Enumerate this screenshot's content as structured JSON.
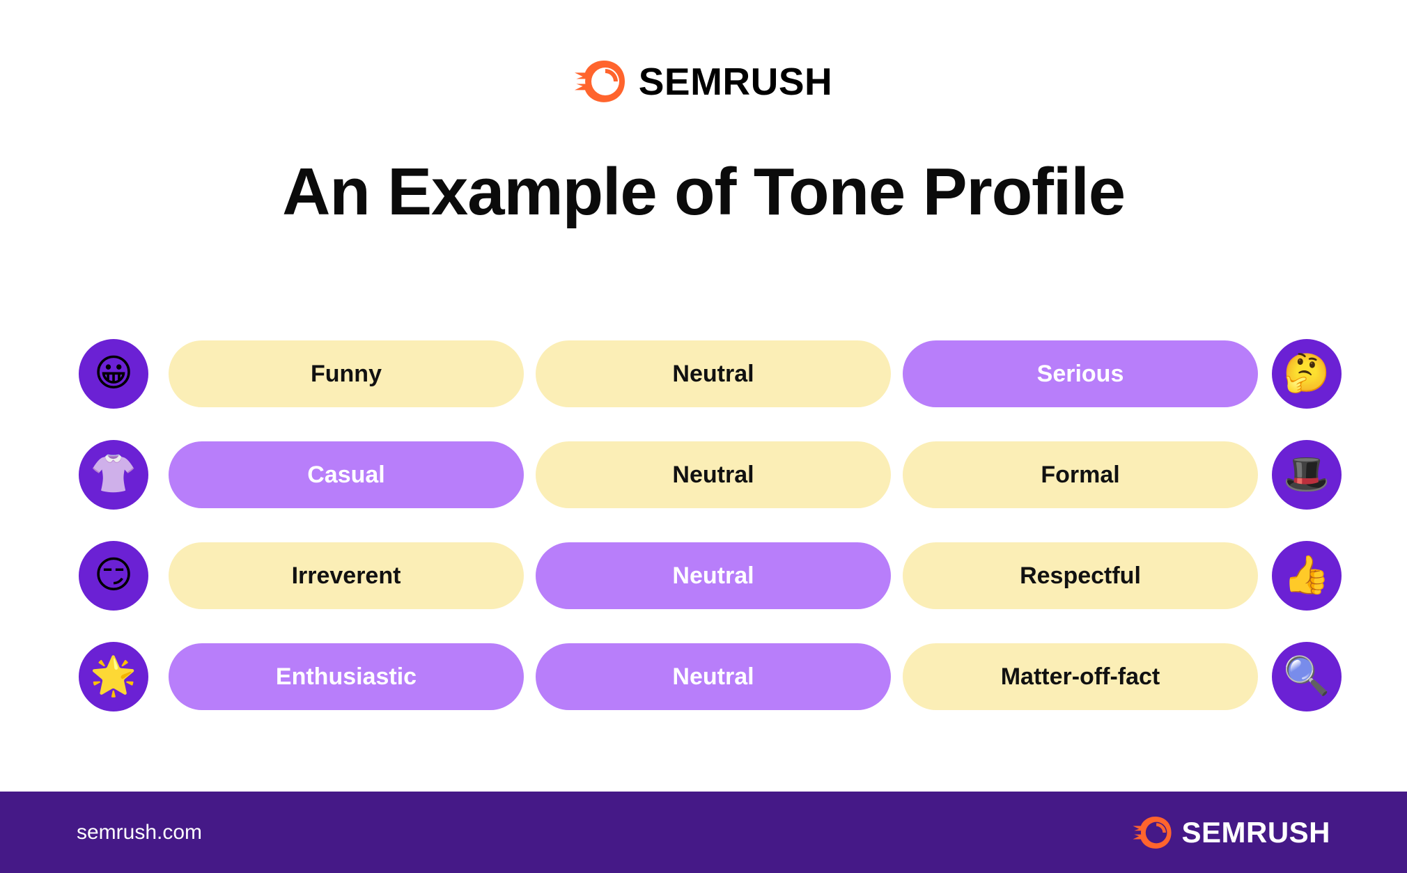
{
  "brand": {
    "name": "SEMRUSH",
    "accent_orange": "#FF642D",
    "footer_purple": "#451987",
    "icon_circle_purple": "#6B21D4",
    "pill_active_purple": "#B87EFA",
    "pill_inactive_yellow": "#FBEEB6",
    "logo_icon": "semrush-comet-icon"
  },
  "header": {
    "logo_text": "SEMRUSH"
  },
  "title": "An Example of Tone Profile",
  "tone_profile": {
    "rows": [
      {
        "left_icon": "grinning-face-emoji",
        "left_icon_glyph": "😀",
        "right_icon": "thinking-face-emoji",
        "right_icon_glyph": "🤔",
        "options": [
          {
            "label": "Funny",
            "selected": false
          },
          {
            "label": "Neutral",
            "selected": false
          },
          {
            "label": "Serious",
            "selected": true
          }
        ]
      },
      {
        "left_icon": "t-shirt-emoji",
        "left_icon_glyph": "👚",
        "right_icon": "top-hat-emoji",
        "right_icon_glyph": "🎩",
        "options": [
          {
            "label": "Casual",
            "selected": true
          },
          {
            "label": "Neutral",
            "selected": false
          },
          {
            "label": "Formal",
            "selected": false
          }
        ]
      },
      {
        "left_icon": "smirking-face-emoji",
        "left_icon_glyph": "😏",
        "right_icon": "thumbs-up-emoji",
        "right_icon_glyph": "👍",
        "options": [
          {
            "label": "Irreverent",
            "selected": false
          },
          {
            "label": "Neutral",
            "selected": true
          },
          {
            "label": "Respectful",
            "selected": false
          }
        ]
      },
      {
        "left_icon": "glowing-star-emoji",
        "left_icon_glyph": "🌟",
        "right_icon": "magnifying-glass-emoji",
        "right_icon_glyph": "🔍",
        "options": [
          {
            "label": "Enthusiastic",
            "selected": true
          },
          {
            "label": "Neutral",
            "selected": true
          },
          {
            "label": "Matter-off-fact",
            "selected": false
          }
        ]
      }
    ]
  },
  "footer": {
    "url": "semrush.com",
    "logo_text": "SEMRUSH"
  }
}
